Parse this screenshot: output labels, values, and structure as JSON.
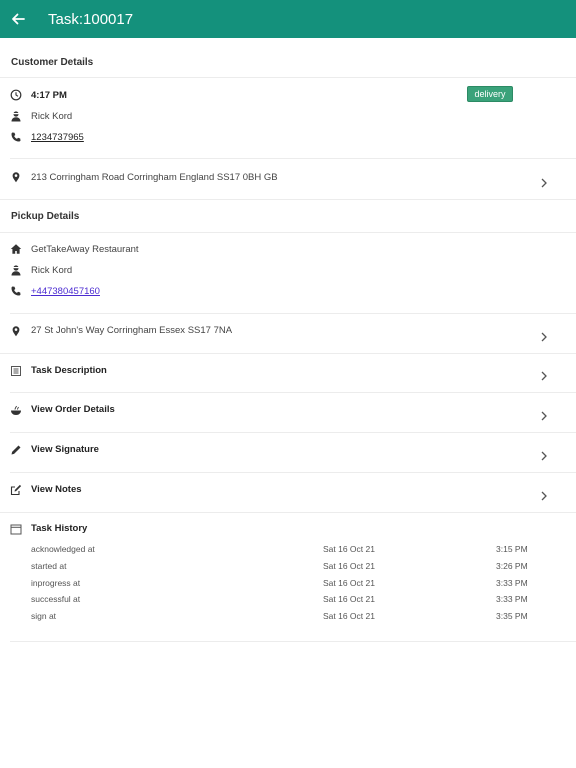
{
  "header": {
    "title": "Task:100017",
    "back_icon": "arrow-left-icon"
  },
  "customer": {
    "section_title": "Customer Details",
    "time": "4:17 PM",
    "badge": "delivery",
    "name": "Rick Kord",
    "phone": "1234737965",
    "address": "213 Corringham Road Corringham England SS17 0BH GB"
  },
  "pickup": {
    "section_title": "Pickup Details",
    "restaurant": "GetTakeAway Restaurant",
    "name": "Rick Kord",
    "phone": "+447380457160",
    "address": "27 St John's Way Corringham Essex SS17 7NA"
  },
  "actions": {
    "task_description": "Task Description",
    "view_order_details": "View Order Details",
    "view_signature": "View Signature",
    "view_notes": "View Notes"
  },
  "history": {
    "title": "Task History",
    "rows": [
      {
        "label": "acknowledged at",
        "date": "Sat 16 Oct 21",
        "time": "3:15 PM"
      },
      {
        "label": "started at",
        "date": "Sat 16 Oct 21",
        "time": "3:26 PM"
      },
      {
        "label": "inprogress at",
        "date": "Sat 16 Oct 21",
        "time": "3:33 PM"
      },
      {
        "label": "successful at",
        "date": "Sat 16 Oct 21",
        "time": "3:33 PM"
      },
      {
        "label": "sign at",
        "date": "Sat 16 Oct 21",
        "time": "3:35 PM"
      }
    ]
  },
  "colors": {
    "header": "#14917c",
    "badge": "#3aa27a",
    "link": "#4b2bd1"
  }
}
